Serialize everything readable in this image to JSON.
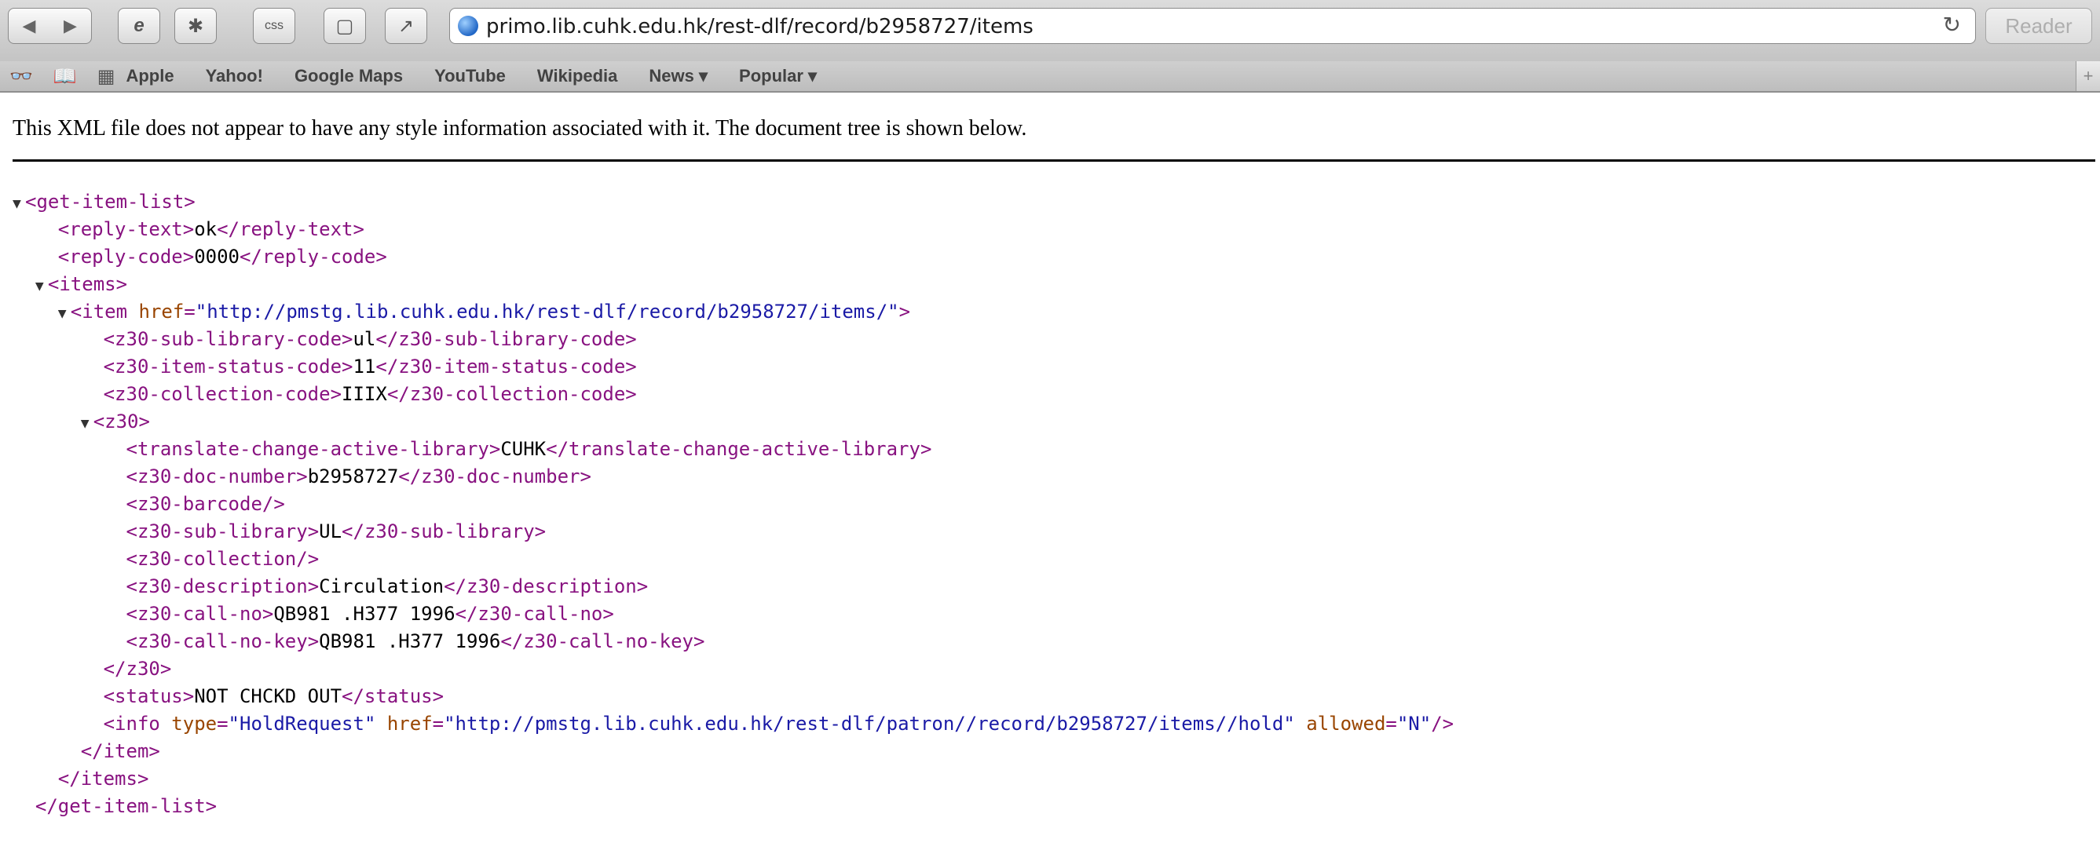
{
  "browser": {
    "url": "primo.lib.cuhk.edu.hk/rest-dlf/record/b2958727/items",
    "reader_label": "Reader",
    "bookmarks": [
      "Apple",
      "Yahoo!",
      "Google Maps",
      "YouTube",
      "Wikipedia",
      "News ▾",
      "Popular ▾"
    ]
  },
  "notice": "This XML file does not appear to have any style information associated with it. The document tree is shown below.",
  "xml": {
    "l1": "<get-item-list>",
    "l2a": "<reply-text>",
    "l2b": "ok",
    "l2c": "</reply-text>",
    "l3a": "<reply-code>",
    "l3b": "0000",
    "l3c": "</reply-code>",
    "l4": "<items>",
    "l5a": "<item",
    "l5b": "href",
    "l5c": "\"http://pmstg.lib.cuhk.edu.hk/rest-dlf/record/b2958727/items/\"",
    "l5d": ">",
    "l6a": "<z30-sub-library-code>",
    "l6b": "ul",
    "l6c": "</z30-sub-library-code>",
    "l7a": "<z30-item-status-code>",
    "l7b": "11",
    "l7c": "</z30-item-status-code>",
    "l8a": "<z30-collection-code>",
    "l8b": "IIIX",
    "l8c": "</z30-collection-code>",
    "l9": "<z30>",
    "l10a": "<translate-change-active-library>",
    "l10b": "CUHK",
    "l10c": "</translate-change-active-library>",
    "l11a": "<z30-doc-number>",
    "l11b": "b2958727",
    "l11c": "</z30-doc-number>",
    "l12": "<z30-barcode/>",
    "l13a": "<z30-sub-library>",
    "l13b": "UL",
    "l13c": "</z30-sub-library>",
    "l14": "<z30-collection/>",
    "l15a": "<z30-description>",
    "l15b": "Circulation",
    "l15c": "</z30-description>",
    "l16a": "<z30-call-no>",
    "l16b": "QB981 .H377 1996",
    "l16c": "</z30-call-no>",
    "l17a": "<z30-call-no-key>",
    "l17b": "QB981 .H377 1996",
    "l17c": "</z30-call-no-key>",
    "l18": "</z30>",
    "l19a": "<status>",
    "l19b": "NOT CHCKD OUT",
    "l19c": "</status>",
    "l20a": "<info",
    "l20b": "type",
    "l20c": "\"HoldRequest\"",
    "l20d": "href",
    "l20e": "\"http://pmstg.lib.cuhk.edu.hk/rest-dlf/patron//record/b2958727/items//hold\"",
    "l20f": "allowed",
    "l20g": "\"N\"",
    "l20h": "/>",
    "l21": "</item>",
    "l22": "</items>",
    "l23": "</get-item-list>"
  }
}
